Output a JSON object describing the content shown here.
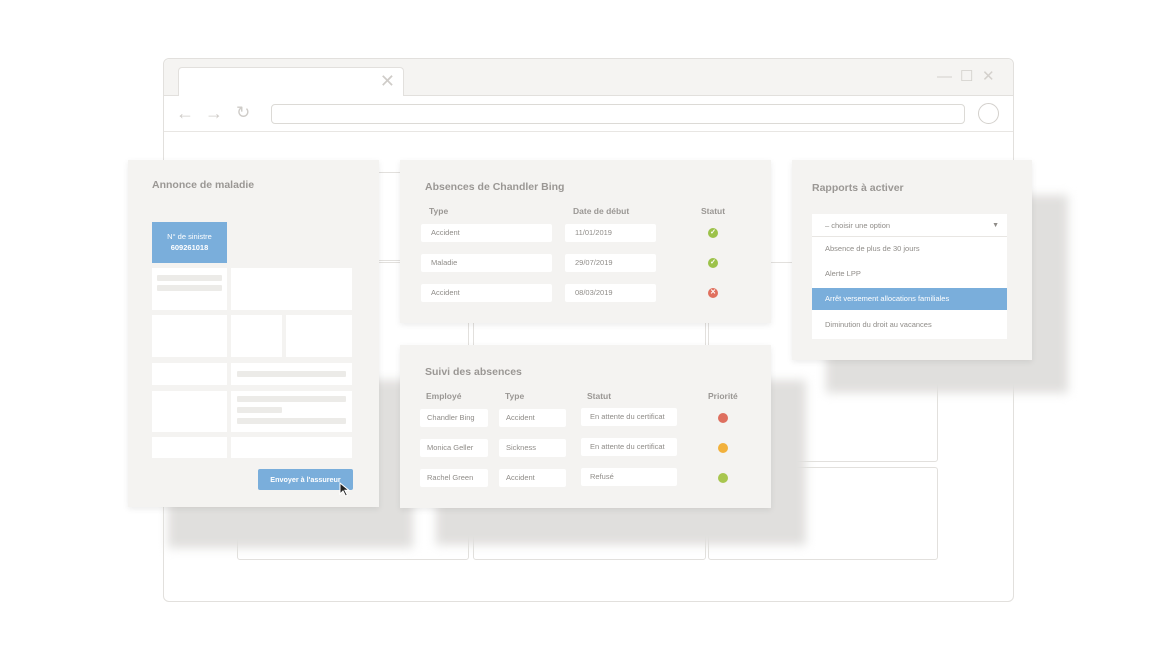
{
  "illness_panel": {
    "title": "Annonce de maladie",
    "claim_label": "N° de sinistre",
    "claim_number": "609261018",
    "send_button": "Envoyer à l'assureur"
  },
  "absences_panel": {
    "title": "Absences de Chandler Bing",
    "headers": [
      "Type",
      "Date de début",
      "Statut"
    ],
    "rows": [
      {
        "type": "Accident",
        "date": "11/01/2019",
        "status": "ok"
      },
      {
        "type": "Maladie",
        "date": "29/07/2019",
        "status": "ok"
      },
      {
        "type": "Accident",
        "date": "08/03/2019",
        "status": "error"
      }
    ]
  },
  "tracking_panel": {
    "title": "Suivi des absences",
    "headers": [
      "Employé",
      "Type",
      "Statut",
      "Priorité"
    ],
    "rows": [
      {
        "employee": "Chandler Bing",
        "type": "Accident",
        "status": "En attente du certificat",
        "priority": "high"
      },
      {
        "employee": "Monica Geller",
        "type": "Sickness",
        "status": "En attente du certificat",
        "priority": "medium"
      },
      {
        "employee": "Rachel Green",
        "type": "Accident",
        "status": "Refusé",
        "priority": "low"
      }
    ]
  },
  "reports_panel": {
    "title": "Rapports à activer",
    "select_placeholder": "– choisir une option",
    "options": [
      "Absence de plus de 30 jours",
      "Alerte LPP",
      "Arrêt versement allocations familiales",
      "Diminution du droit au vacances"
    ],
    "selected_index": 2
  },
  "colors": {
    "accent": "#7aaedb",
    "ok": "#9cc24a",
    "error": "#e0705e",
    "priority_high": "#de6f5f",
    "priority_medium": "#f2b13c",
    "priority_low": "#a8c64f"
  }
}
